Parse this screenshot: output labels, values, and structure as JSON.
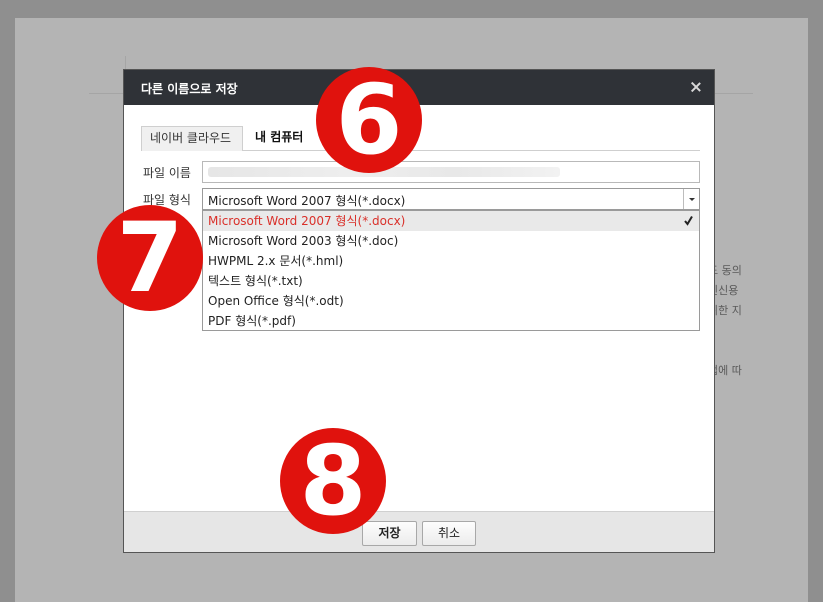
{
  "document": {
    "side_text": [
      "도 동의",
      "인신용",
      "위한 지",
      "법에 따"
    ]
  },
  "dialog": {
    "title": "다른 이름으로 저장",
    "close_icon": "close-icon",
    "tabs": [
      {
        "label": "네이버 클라우드",
        "active": false
      },
      {
        "label": "내 컴퓨터",
        "active": true
      }
    ],
    "filename_label": "파일 이름",
    "filename_value": "",
    "filetype_label": "파일 형식",
    "filetype_selected": "Microsoft Word 2007 형식(*.docx)",
    "filetype_options": [
      "Microsoft Word 2007 형식(*.docx)",
      "Microsoft Word 2003 형식(*.doc)",
      "HWPML 2.x 문서(*.hml)",
      "텍스트 형식(*.txt)",
      "Open Office 형식(*.odt)",
      "PDF 형식(*.pdf)"
    ],
    "save_label": "저장",
    "cancel_label": "취소"
  },
  "badges": [
    "6",
    "7",
    "8"
  ],
  "colors": {
    "header": "#2f3237",
    "selected_text": "#d9302a",
    "badge": "#e0120d"
  }
}
